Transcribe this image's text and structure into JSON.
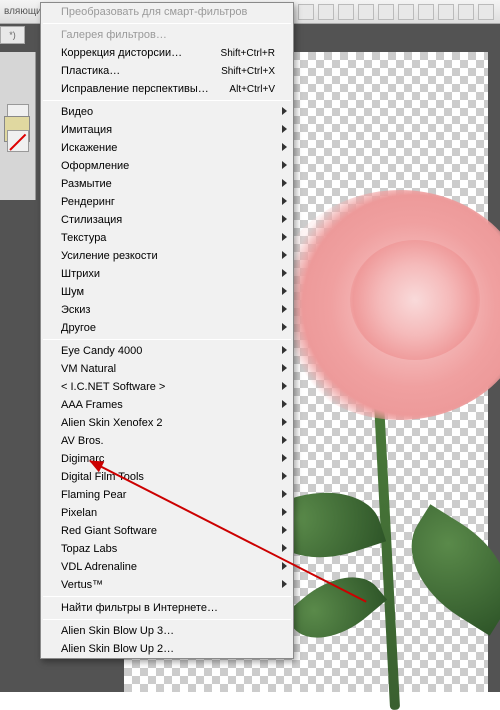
{
  "toolbar": {
    "title_fragment": "вляющие элементы"
  },
  "tab": {
    "label": "*)"
  },
  "menu": {
    "groups": [
      [
        {
          "label": "Преобразовать для смарт-фильтров",
          "disabled": true
        }
      ],
      [
        {
          "label": "Галерея фильтров…",
          "disabled": true
        },
        {
          "label": "Коррекция дисторсии…",
          "shortcut": "Shift+Ctrl+R"
        },
        {
          "label": "Пластика…",
          "shortcut": "Shift+Ctrl+X"
        },
        {
          "label": "Исправление перспективы…",
          "shortcut": "Alt+Ctrl+V"
        }
      ],
      [
        {
          "label": "Видео",
          "submenu": true
        },
        {
          "label": "Имитация",
          "submenu": true
        },
        {
          "label": "Искажение",
          "submenu": true
        },
        {
          "label": "Оформление",
          "submenu": true
        },
        {
          "label": "Размытие",
          "submenu": true
        },
        {
          "label": "Рендеринг",
          "submenu": true
        },
        {
          "label": "Стилизация",
          "submenu": true
        },
        {
          "label": "Текстура",
          "submenu": true
        },
        {
          "label": "Усиление резкости",
          "submenu": true
        },
        {
          "label": "Штрихи",
          "submenu": true
        },
        {
          "label": "Шум",
          "submenu": true
        },
        {
          "label": "Эскиз",
          "submenu": true
        },
        {
          "label": "Другое",
          "submenu": true
        }
      ],
      [
        {
          "label": " Eye Candy 4000",
          "submenu": true
        },
        {
          "label": " VM Natural",
          "submenu": true
        },
        {
          "label": "< I.C.NET Software >",
          "submenu": true
        },
        {
          "label": "AAA Frames",
          "submenu": true
        },
        {
          "label": "Alien Skin Xenofex 2",
          "submenu": true
        },
        {
          "label": "AV Bros.",
          "submenu": true
        },
        {
          "label": "Digimarc",
          "submenu": true
        },
        {
          "label": "Digital Film Tools",
          "submenu": true
        },
        {
          "label": "Flaming Pear",
          "submenu": true
        },
        {
          "label": "Pixelan",
          "submenu": true
        },
        {
          "label": "Red Giant Software",
          "submenu": true
        },
        {
          "label": "Topaz Labs",
          "submenu": true
        },
        {
          "label": "VDL Adrenaline",
          "submenu": true
        },
        {
          "label": "Vertus™",
          "submenu": true
        }
      ],
      [
        {
          "label": "Найти фильтры в Интернете…"
        }
      ],
      [
        {
          "label": "Alien Skin Blow Up 3…"
        },
        {
          "label": "Alien Skin Blow Up 2…"
        }
      ]
    ]
  }
}
